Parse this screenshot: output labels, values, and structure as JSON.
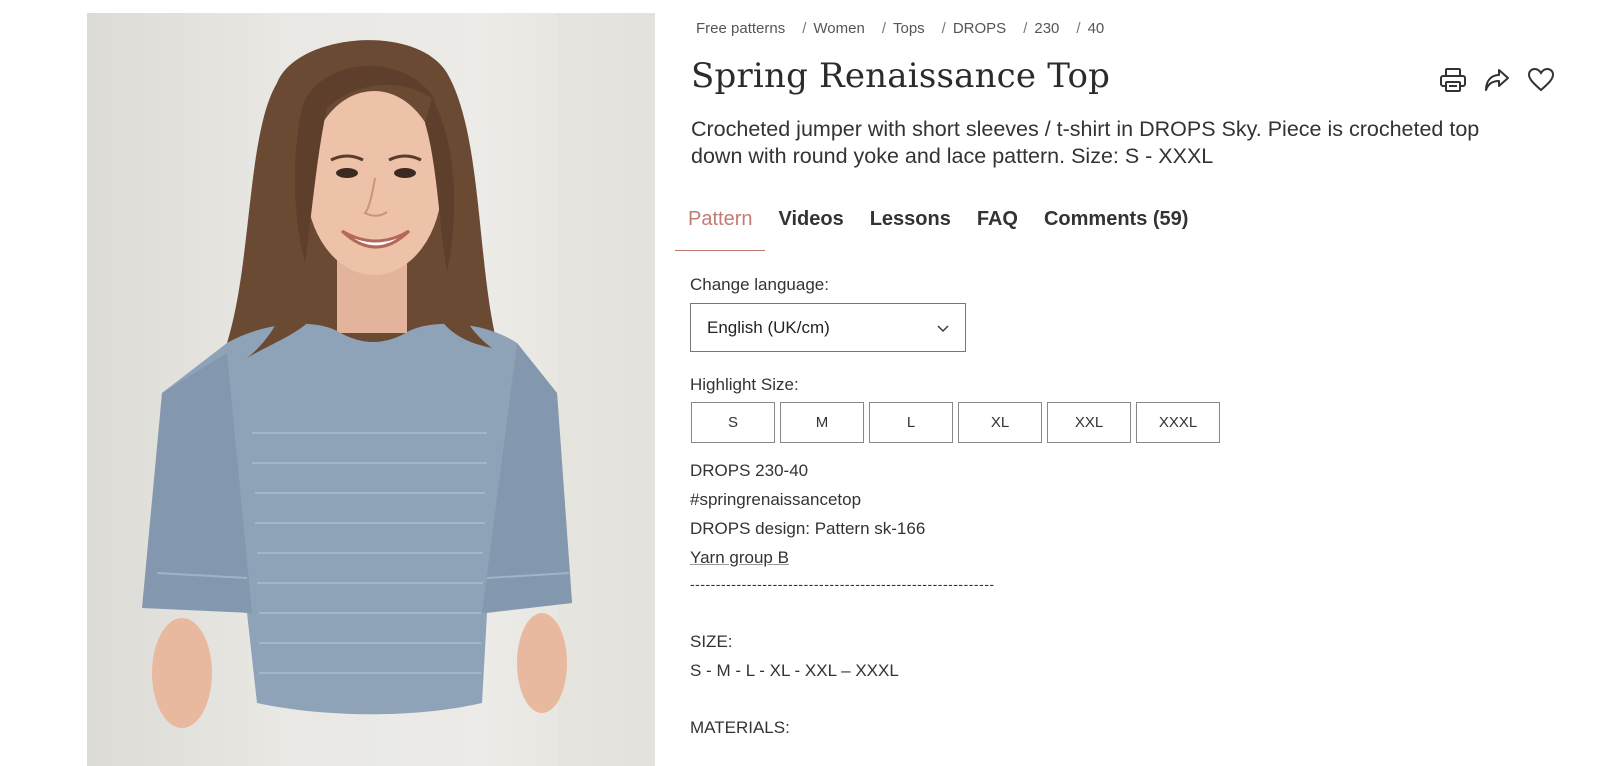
{
  "breadcrumb": [
    "Free patterns",
    "Women",
    "Tops",
    "DROPS",
    "230",
    "40"
  ],
  "title": "Spring Renaissance Top",
  "description": "Crocheted jumper with short sleeves / t-shirt in DROPS Sky. Piece is crocheted top down with round yoke and lace pattern. Size: S - XXXL",
  "actions": {
    "print_icon": "printer-icon",
    "share_icon": "share-icon",
    "favorite_icon": "heart-icon"
  },
  "tabs": [
    {
      "label": "Pattern",
      "active": true
    },
    {
      "label": "Videos",
      "active": false
    },
    {
      "label": "Lessons",
      "active": false
    },
    {
      "label": "FAQ",
      "active": false
    },
    {
      "label": "Comments (59)",
      "active": false
    }
  ],
  "language": {
    "label": "Change language:",
    "selected": "English (UK/cm)"
  },
  "highlight_size": {
    "label": "Highlight Size:",
    "options": [
      "S",
      "M",
      "L",
      "XL",
      "XXL",
      "XXXL"
    ]
  },
  "info": {
    "code": "DROPS 230-40",
    "hashtag": "#springrenaissancetop",
    "design": "DROPS design: Pattern sk-166",
    "yarn_group": "Yarn group B",
    "divider": "-----------------------------------------------------------"
  },
  "size_section": {
    "heading": "SIZE:",
    "sizes": "S - M - L - XL - XXL – XXXL"
  },
  "materials_heading": "MATERIALS:",
  "colors": {
    "accent": "#c27b72",
    "text": "#333333",
    "sweater": "#8fa3b8",
    "hair": "#6b4a34"
  }
}
